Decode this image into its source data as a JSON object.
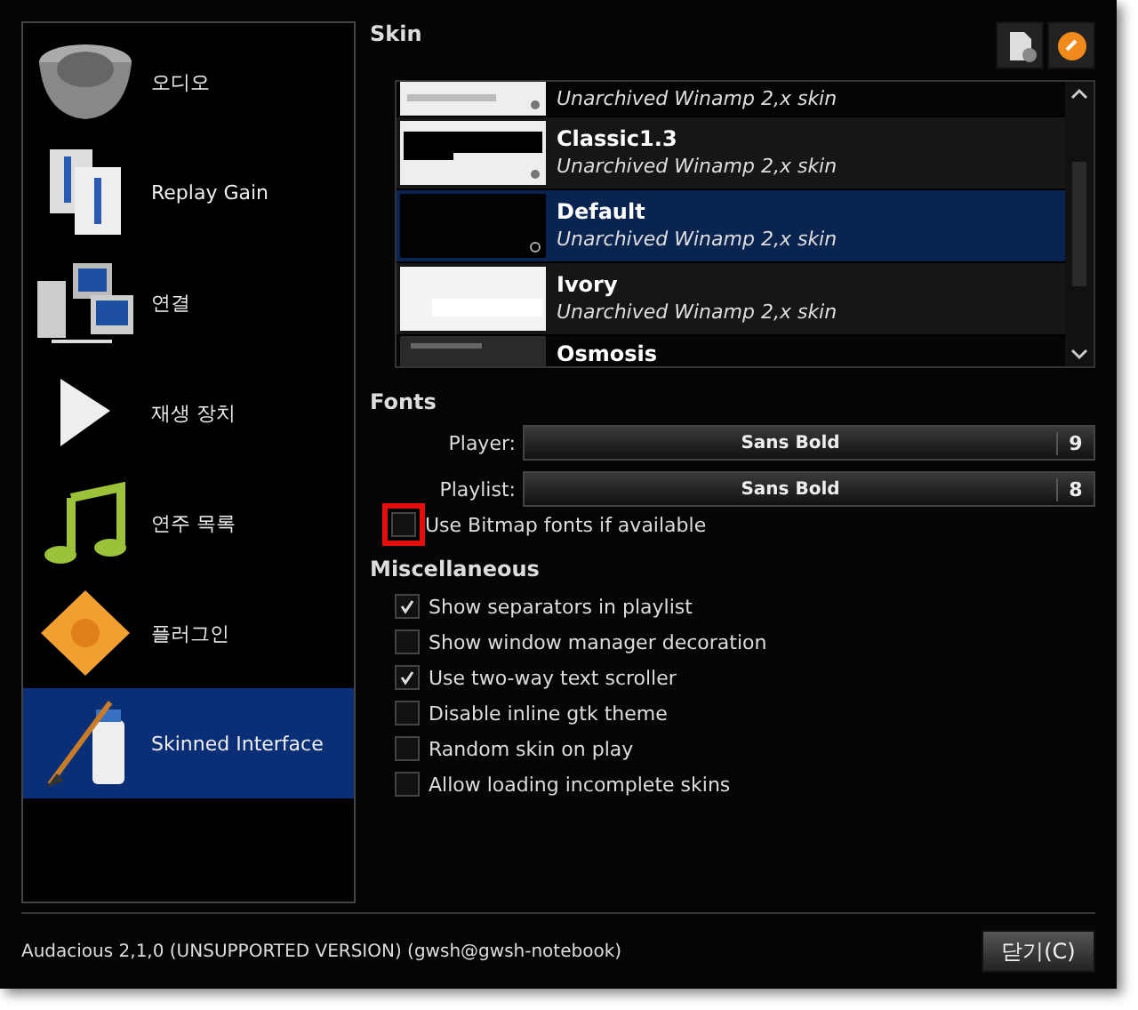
{
  "sidebar": {
    "items": [
      {
        "label": "오디오",
        "selected": false
      },
      {
        "label": "Replay Gain",
        "selected": false
      },
      {
        "label": "연결",
        "selected": false
      },
      {
        "label": "재생 장치",
        "selected": false
      },
      {
        "label": "연주 목록",
        "selected": false
      },
      {
        "label": "플러그인",
        "selected": false
      },
      {
        "label": "Skinned Interface",
        "selected": true
      }
    ]
  },
  "skin": {
    "heading": "Skin",
    "list": [
      {
        "subtitle": "Unarchived Winamp 2,x skin",
        "selected": false
      },
      {
        "name": "Classic1.3",
        "subtitle": "Unarchived Winamp 2,x skin",
        "selected": false
      },
      {
        "name": "Default",
        "subtitle": "Unarchived Winamp 2,x skin",
        "selected": true
      },
      {
        "name": "Ivory",
        "subtitle": "Unarchived Winamp 2,x skin",
        "selected": false
      },
      {
        "name": "Osmosis",
        "selected": false
      }
    ]
  },
  "fonts": {
    "heading": "Fonts",
    "rows": [
      {
        "label": "Player:",
        "font": "Sans Bold",
        "size": "9"
      },
      {
        "label": "Playlist:",
        "font": "Sans Bold",
        "size": "8"
      }
    ],
    "bitmap": {
      "label": "Use Bitmap fonts if available",
      "checked": false,
      "highlighted": true
    }
  },
  "misc": {
    "heading": "Miscellaneous",
    "options": [
      {
        "label": "Show separators in playlist",
        "checked": true
      },
      {
        "label": "Show window manager decoration",
        "checked": false
      },
      {
        "label": "Use two-way text scroller",
        "checked": true
      },
      {
        "label": "Disable inline gtk theme",
        "checked": false
      },
      {
        "label": "Random skin on play",
        "checked": false
      },
      {
        "label": "Allow loading incomplete skins",
        "checked": false
      }
    ]
  },
  "status_bar": {
    "text": "Audacious 2,1,0 (UNSUPPORTED VERSION) (gwsh@gwsh-notebook)",
    "button": "닫기(C)"
  }
}
